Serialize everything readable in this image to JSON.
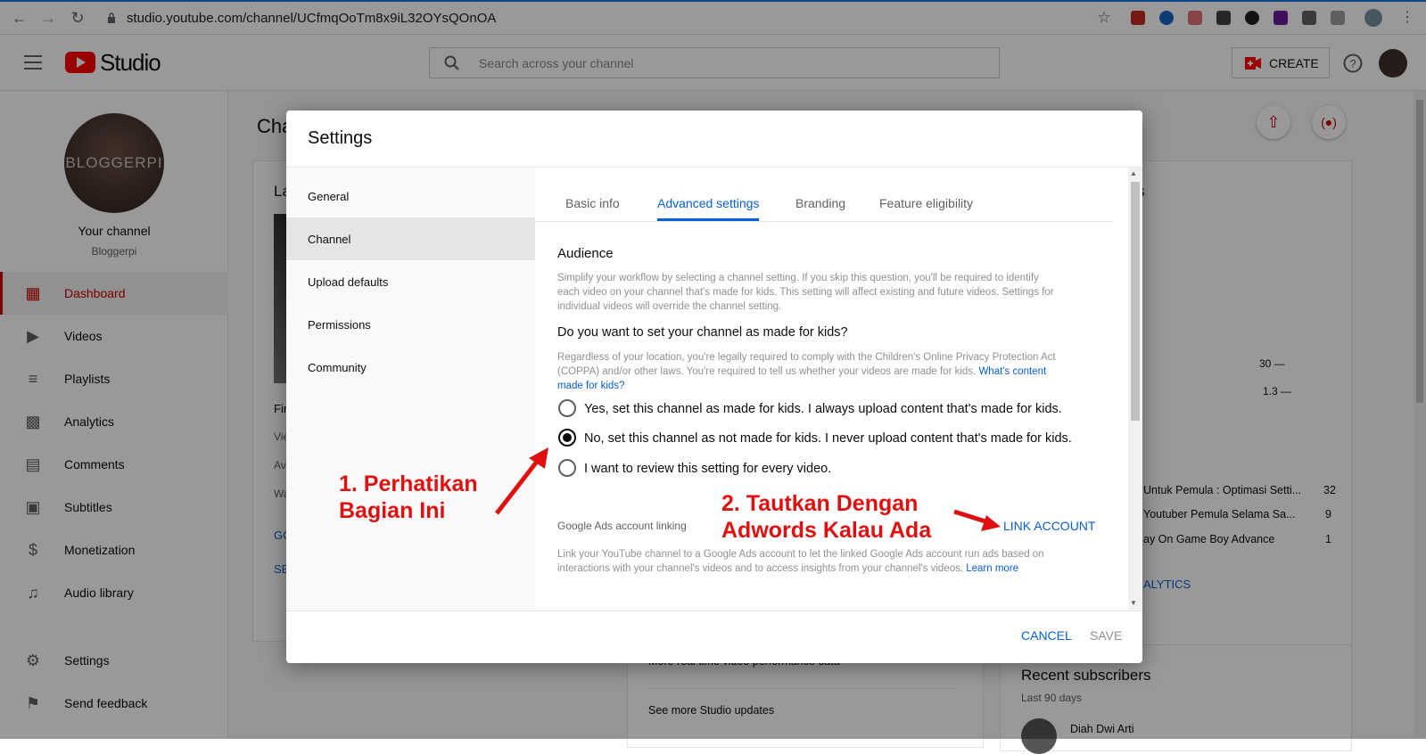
{
  "browser": {
    "url": "studio.youtube.com/channel/UCfmqOoTm8x9iL32OYsQOnOA"
  },
  "topbar": {
    "logo_text": "Studio",
    "search_placeholder": "Search across your channel",
    "create_label": "CREATE"
  },
  "sidebar": {
    "avatar_text": "BLOGGERPI",
    "channel_title": "Your channel",
    "channel_name": "Bloggerpi",
    "items": [
      {
        "label": "Dashboard",
        "icon": "dashboard-icon"
      },
      {
        "label": "Videos",
        "icon": "videos-icon"
      },
      {
        "label": "Playlists",
        "icon": "playlists-icon"
      },
      {
        "label": "Analytics",
        "icon": "analytics-icon"
      },
      {
        "label": "Comments",
        "icon": "comments-icon"
      },
      {
        "label": "Subtitles",
        "icon": "subtitles-icon"
      },
      {
        "label": "Monetization",
        "icon": "monetization-icon"
      },
      {
        "label": "Audio library",
        "icon": "audio-library-icon"
      },
      {
        "label": "Settings",
        "icon": "gear-icon"
      },
      {
        "label": "Send feedback",
        "icon": "feedback-icon"
      }
    ]
  },
  "background": {
    "page_title": "Cha",
    "card_title": "La",
    "frag_fir": "Fir",
    "frag_vie": "Vie",
    "frag_av": "Av",
    "frag_wa": "Wa",
    "frag_go": "GO",
    "frag_se": "SE",
    "frag_s": "s",
    "val_30": "30",
    "val_13": "1.3",
    "rows": [
      {
        "title": "Untuk Pemula : Optimasi Setti...",
        "count": "32"
      },
      {
        "title": "Youtuber Pemula Selama Sa...",
        "count": "9"
      },
      {
        "title": "ay On Game Boy Advance",
        "count": "1"
      }
    ],
    "analytics_link": "ALYTICS",
    "news_1": "More real time video performance data",
    "news_2": "See more Studio updates",
    "recent_subs_title": "Recent subscribers",
    "recent_subs_sub": "Last 90 days",
    "subscriber_name": "Diah Dwi Arti"
  },
  "dialog": {
    "title": "Settings",
    "nav": [
      "General",
      "Channel",
      "Upload defaults",
      "Permissions",
      "Community"
    ],
    "tabs": [
      "Basic info",
      "Advanced settings",
      "Branding",
      "Feature eligibility"
    ],
    "audience_heading": "Audience",
    "audience_desc_1": "Simplify your workflow by selecting a channel setting. If you skip this question, you'll be required to identify",
    "audience_desc_2": "each video on your channel that's made for kids. This setting will affect existing and future videos. Settings for",
    "audience_desc_3": "individual videos will override the channel setting.",
    "question": "Do you want to set your channel as made for kids?",
    "coppa_1": "Regardless of your location, you're legally required to comply with the Children's Online Privacy Protection Act",
    "coppa_2": "(COPPA) and/or other laws. You're required to tell us whether your videos are made for kids.",
    "coppa_link_1": "What's content",
    "coppa_link_2": "made for kids?",
    "options": [
      "Yes, set this channel as made for kids. I always upload content that's made for kids.",
      "No, set this channel as not made for kids. I never upload content that's made for kids.",
      "I want to review this setting for every video."
    ],
    "ads_heading": "Google Ads account linking",
    "link_account": "LINK ACCOUNT",
    "ads_desc_1": "Link your YouTube channel to a Google Ads account to let the linked Google Ads account run ads based on",
    "ads_desc_2": "interactions with your channel's videos and to access insights from your channel's videos.",
    "learn_more": "Learn more",
    "cancel": "CANCEL",
    "save": "SAVE"
  },
  "annotations": {
    "note1_line1": "1. Perhatikan",
    "note1_line2": "Bagian Ini",
    "note2_line1": "2. Tautkan Dengan",
    "note2_line2": "Adwords Kalau Ada"
  }
}
